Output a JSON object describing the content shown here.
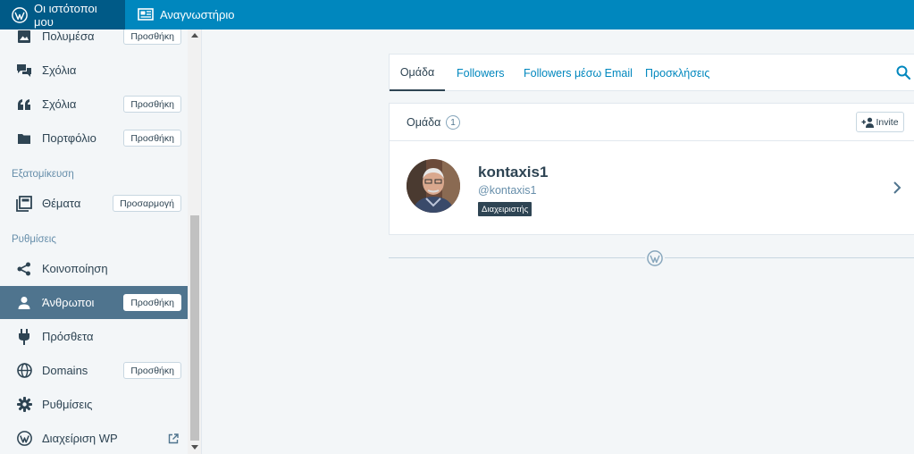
{
  "masterbar": {
    "my_sites": "Οι ιστότοποι μου",
    "reader": "Αναγνωστήριο",
    "brand_color": "#0087be"
  },
  "sidebar": {
    "items": [
      {
        "label": "Πολυμέσα",
        "button": "Προσθήκη",
        "icon": "media-icon"
      },
      {
        "label": "Σχόλια",
        "button": "",
        "icon": "comments-icon"
      },
      {
        "label": "Σχόλια",
        "button": "Προσθήκη",
        "icon": "quote-icon"
      },
      {
        "label": "Πορτφόλιο",
        "button": "Προσθήκη",
        "icon": "folder-icon"
      },
      {
        "label": "Θέματα",
        "button": "Προσαρμογή",
        "icon": "themes-icon"
      },
      {
        "label": "Κοινοποίηση",
        "button": "",
        "icon": "share-icon"
      },
      {
        "label": "Άνθρωποι",
        "button": "Προσθήκη",
        "icon": "person-icon",
        "selected": true
      },
      {
        "label": "Πρόσθετα",
        "button": "",
        "icon": "plugin-icon"
      },
      {
        "label": "Domains",
        "button": "Προσθήκη",
        "icon": "globe-icon"
      },
      {
        "label": "Ρυθμίσεις",
        "button": "",
        "icon": "gear-icon"
      },
      {
        "label": "Διαχείριση WP",
        "button": "",
        "icon": "wordpress-icon"
      }
    ],
    "headings": {
      "personalize": "Εξατομίκευση",
      "settings": "Ρυθμίσεις"
    }
  },
  "section_nav": {
    "tabs": [
      "Ομάδα",
      "Followers",
      "Followers μέσω Email",
      "Προσκλήσεις"
    ],
    "active": "Ομάδα"
  },
  "team": {
    "title": "Ομάδα",
    "count": "1",
    "invite_label": "Invite",
    "member": {
      "name": "kontaxis1",
      "handle": "@kontaxis1",
      "role": "Διαχειριστής"
    }
  }
}
